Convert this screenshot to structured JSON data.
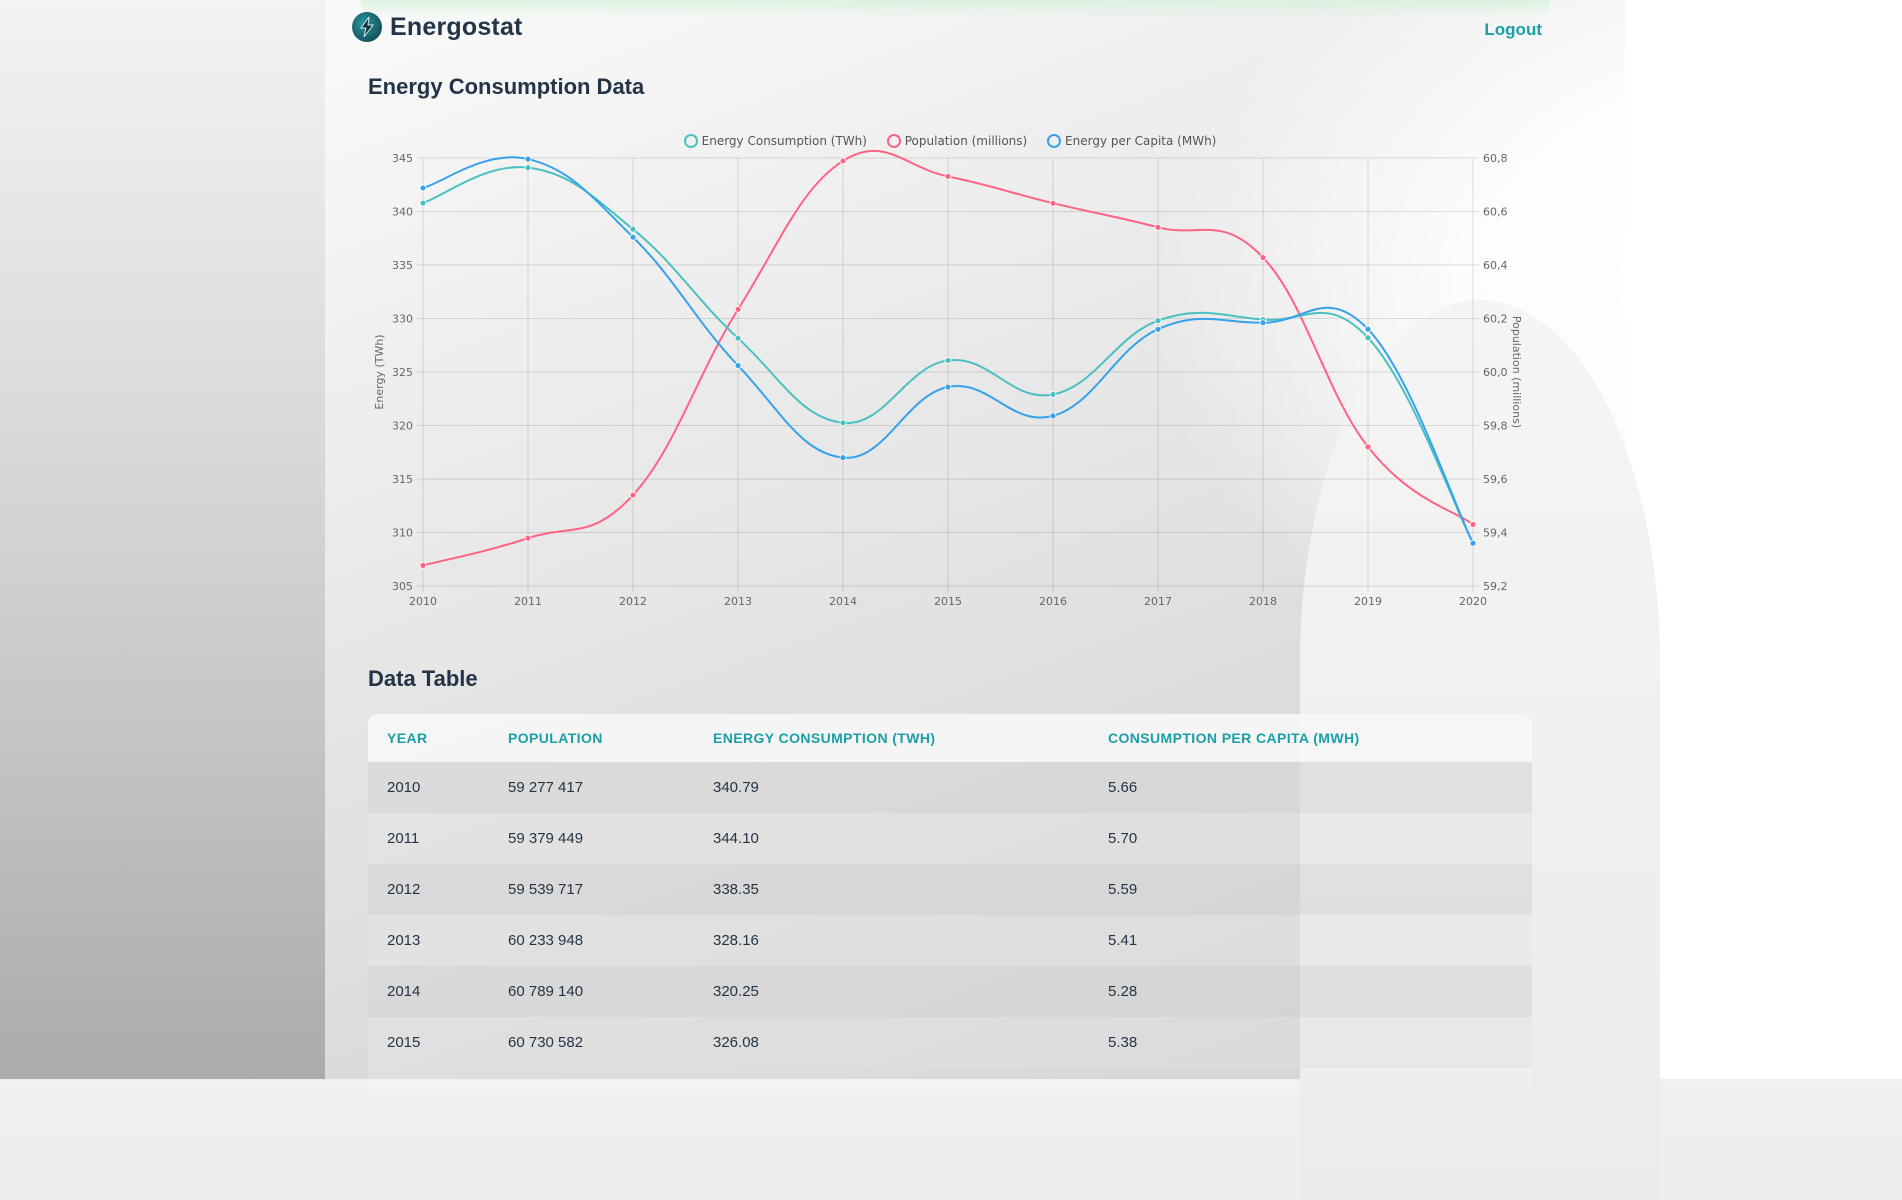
{
  "app": {
    "brand": "Energostat",
    "logout_label": "Logout",
    "accent": "#1a9fa7"
  },
  "sections": {
    "chart_title": "Energy Consumption Data",
    "table_title": "Data Table"
  },
  "chart_data": {
    "type": "line",
    "x": [
      "2010",
      "2011",
      "2012",
      "2013",
      "2014",
      "2015",
      "2016",
      "2017",
      "2018",
      "2019",
      "2020"
    ],
    "series": [
      {
        "name": "Energy Consumption (TWh)",
        "color": "#4bc0c0",
        "axis": "left",
        "values": [
          340.79,
          344.1,
          338.35,
          328.16,
          320.25,
          326.08,
          322.9,
          329.8,
          329.9,
          328.2,
          309.0
        ]
      },
      {
        "name": "Population (millions)",
        "color": "#ff6384",
        "axis": "right",
        "values": [
          59.277,
          59.379,
          59.54,
          60.234,
          60.789,
          60.731,
          60.631,
          60.541,
          60.428,
          59.72,
          59.43
        ]
      },
      {
        "name": "Energy per Capita (MWh)",
        "color": "#36a2eb",
        "axis": "left",
        "values": [
          342.2,
          344.9,
          337.6,
          325.6,
          317.0,
          323.6,
          320.9,
          329.0,
          329.6,
          329.0,
          309.0
        ]
      }
    ],
    "ylabel_left": "Energy (TWh)",
    "ylabel_right": "Population (millions)",
    "ylim_left": [
      305,
      345
    ],
    "ylim_right": [
      59.2,
      60.8
    ],
    "yticks_left": [
      "345",
      "340",
      "335",
      "330",
      "325",
      "320",
      "315",
      "310",
      "305"
    ],
    "yticks_right": [
      "60,8",
      "60,6",
      "60,4",
      "60,2",
      "60,0",
      "59,8",
      "59,6",
      "59,4",
      "59,2"
    ],
    "grid": true,
    "legend": "top"
  },
  "table": {
    "headers": [
      "Year",
      "Population",
      "Energy Consumption (TWh)",
      "Consumption per Capita (MWh)"
    ],
    "rows": [
      [
        "2010",
        "59 277 417",
        "340.79",
        "5.66"
      ],
      [
        "2011",
        "59 379 449",
        "344.10",
        "5.70"
      ],
      [
        "2012",
        "59 539 717",
        "338.35",
        "5.59"
      ],
      [
        "2013",
        "60 233 948",
        "328.16",
        "5.41"
      ],
      [
        "2014",
        "60 789 140",
        "320.25",
        "5.28"
      ],
      [
        "2015",
        "60 730 582",
        "326.08",
        "5.38"
      ]
    ]
  }
}
